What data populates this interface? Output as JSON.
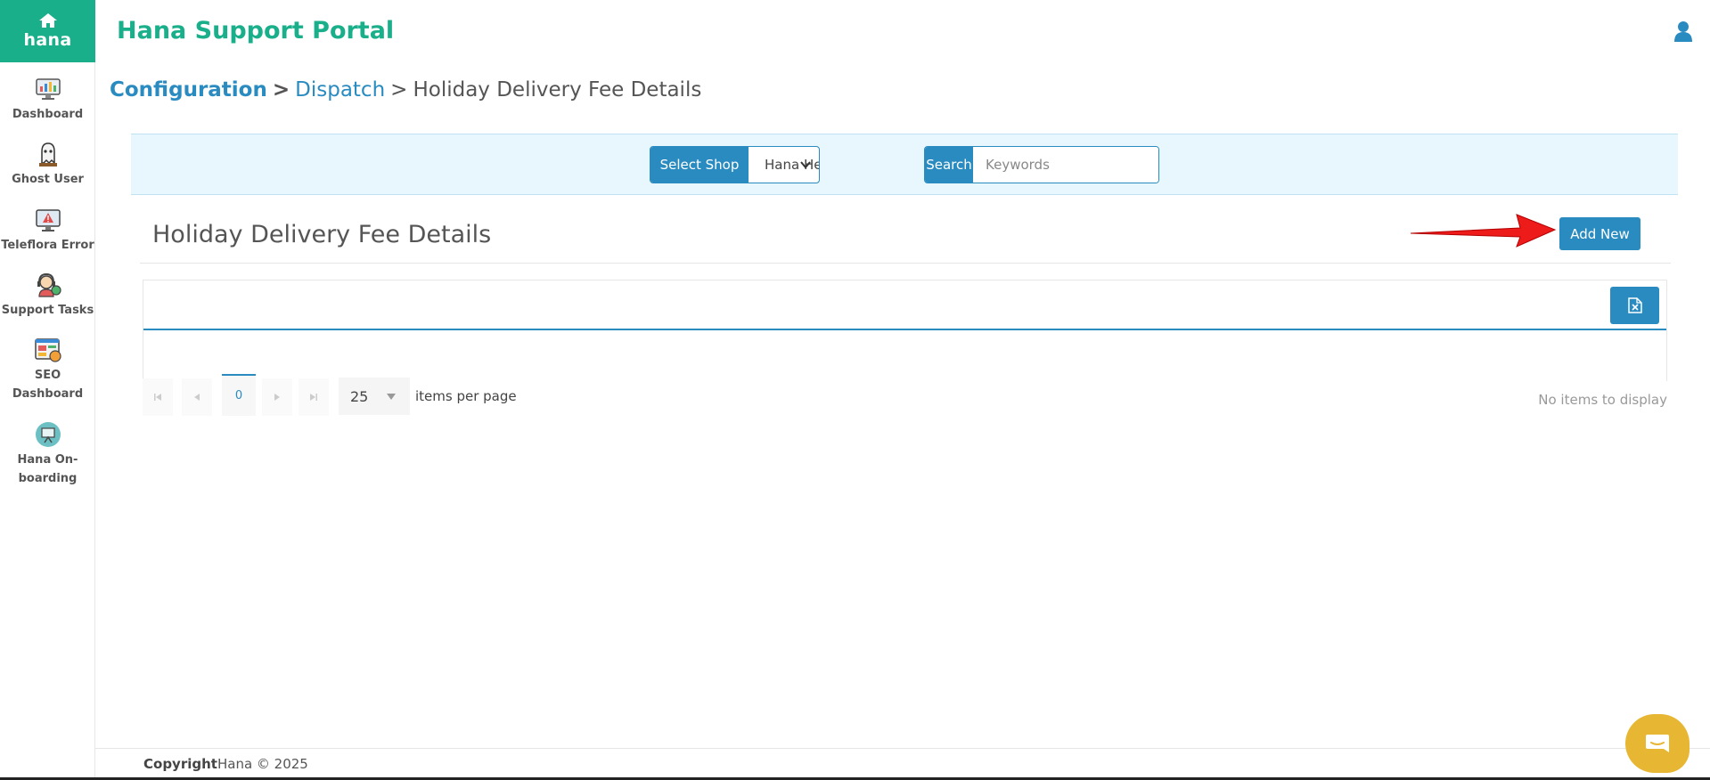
{
  "brand": {
    "name": "hana"
  },
  "header": {
    "title": "Hana Support Portal"
  },
  "sidebar": {
    "items": [
      {
        "label": "Dashboard",
        "icon": "dashboard-icon"
      },
      {
        "label": "Ghost User",
        "icon": "ghost-user-icon"
      },
      {
        "label": "Teleflora Error",
        "icon": "teleflora-error-icon"
      },
      {
        "label": "Support Tasks",
        "icon": "support-tasks-icon"
      },
      {
        "label": "SEO Dashboard",
        "icon": "seo-dashboard-icon"
      },
      {
        "label": "Hana On-boarding",
        "icon": "onboarding-icon"
      }
    ]
  },
  "breadcrumb": {
    "level1": "Configuration",
    "level2": "Dispatch",
    "level3": "Holiday Delivery Fee Details",
    "separator": ">"
  },
  "filters": {
    "shop_label": "Select Shop",
    "shop_value": "Hana HeadQuarter",
    "search_label": "Search",
    "search_placeholder": "Keywords"
  },
  "section": {
    "title": "Holiday Delivery Fee Details",
    "add_button": "Add New"
  },
  "pager": {
    "current_page": "0",
    "page_size": "25",
    "items_per_page_label": "items per page",
    "status": "No items to display"
  },
  "footer": {
    "copyright_label": "Copyright",
    "copyright_text": "Hana © 2025"
  },
  "colors": {
    "brand_green": "#1aaf8b",
    "primary_blue": "#2a8bc1",
    "chat_yellow": "#e7b632"
  }
}
